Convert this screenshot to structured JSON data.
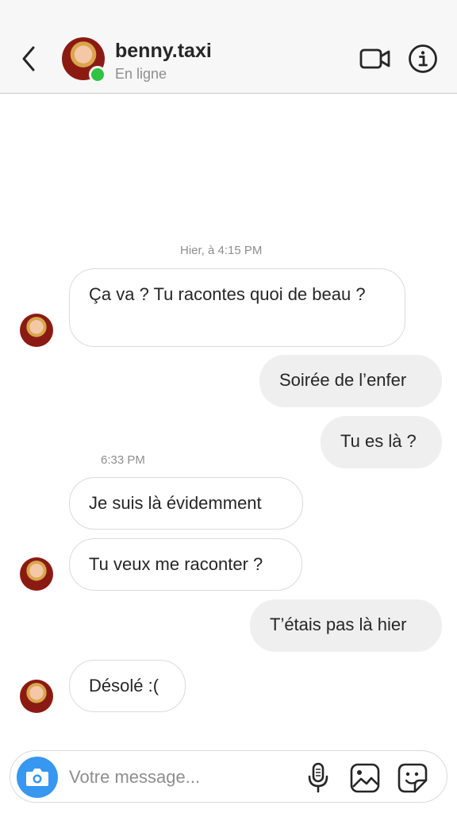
{
  "header": {
    "username": "benny.taxi",
    "status": "En ligne"
  },
  "thread": {
    "timestamps": [
      "Hier, à 4:15 PM",
      "6:33 PM"
    ],
    "messages": [
      {
        "direction": "in",
        "text": "Ça va ? Tu racontes quoi de beau ?"
      },
      {
        "direction": "out",
        "text": "Soirée de l’enfer"
      },
      {
        "direction": "out",
        "text": "Tu es là ?"
      },
      {
        "direction": "in",
        "text": "Je suis là évidemment"
      },
      {
        "direction": "in",
        "text": "Tu veux me raconter ?"
      },
      {
        "direction": "out",
        "text": "T’étais pas là hier"
      },
      {
        "direction": "in",
        "text": "Désolé :("
      }
    ]
  },
  "composer": {
    "placeholder": "Votre message..."
  },
  "colors": {
    "accent": "#3897f0",
    "online": "#2ec341",
    "outgoing_bubble": "#efefef",
    "secondary_text": "#8e8e8e"
  }
}
